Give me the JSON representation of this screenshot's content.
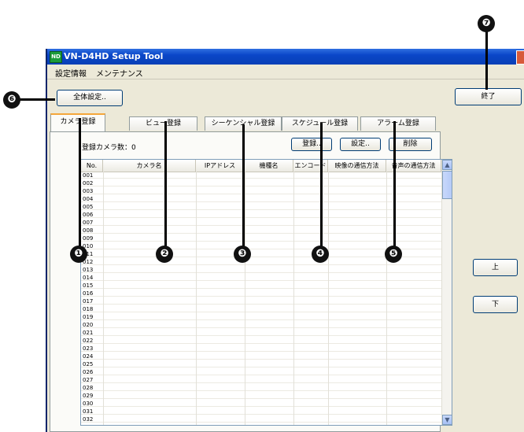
{
  "window": {
    "icon_text": "ND",
    "title": "VN-D4HD Setup Tool",
    "close_icon": "close-icon"
  },
  "menu": {
    "items": [
      "設定情報",
      "メンテナンス"
    ]
  },
  "toolbar": {
    "settings_label": "全体設定..",
    "exit_label": "終了"
  },
  "tabs": [
    {
      "label": "カメラ登録",
      "active": true
    },
    {
      "label": "ビュー登録",
      "active": false
    },
    {
      "label": "シーケンシャル登録",
      "active": false
    },
    {
      "label": "スケジュール登録",
      "active": false
    },
    {
      "label": "アラーム登録",
      "active": false
    }
  ],
  "camera_panel": {
    "count_label": "登録カメラ数：0",
    "register_label": "登録..",
    "settings_label": "設定..",
    "delete_label": "削除"
  },
  "table": {
    "columns": [
      "No.",
      "カメラ名",
      "IPアドレス",
      "機種名",
      "エンコード",
      "映像の通信方法",
      "音声の通信方法"
    ],
    "rows": [
      "001",
      "002",
      "003",
      "004",
      "005",
      "006",
      "007",
      "008",
      "009",
      "010",
      "011",
      "012",
      "013",
      "014",
      "015",
      "016",
      "017",
      "018",
      "019",
      "020",
      "021",
      "022",
      "023",
      "024",
      "025",
      "026",
      "027",
      "028",
      "029",
      "030",
      "031",
      "032"
    ]
  },
  "side_buttons": {
    "up_label": "上",
    "down_label": "下"
  },
  "scrollbar": {
    "up_glyph": "▲",
    "down_glyph": "▼"
  },
  "callouts": [
    "❶",
    "❷",
    "❸",
    "❹",
    "❺",
    "❻",
    "❼"
  ]
}
